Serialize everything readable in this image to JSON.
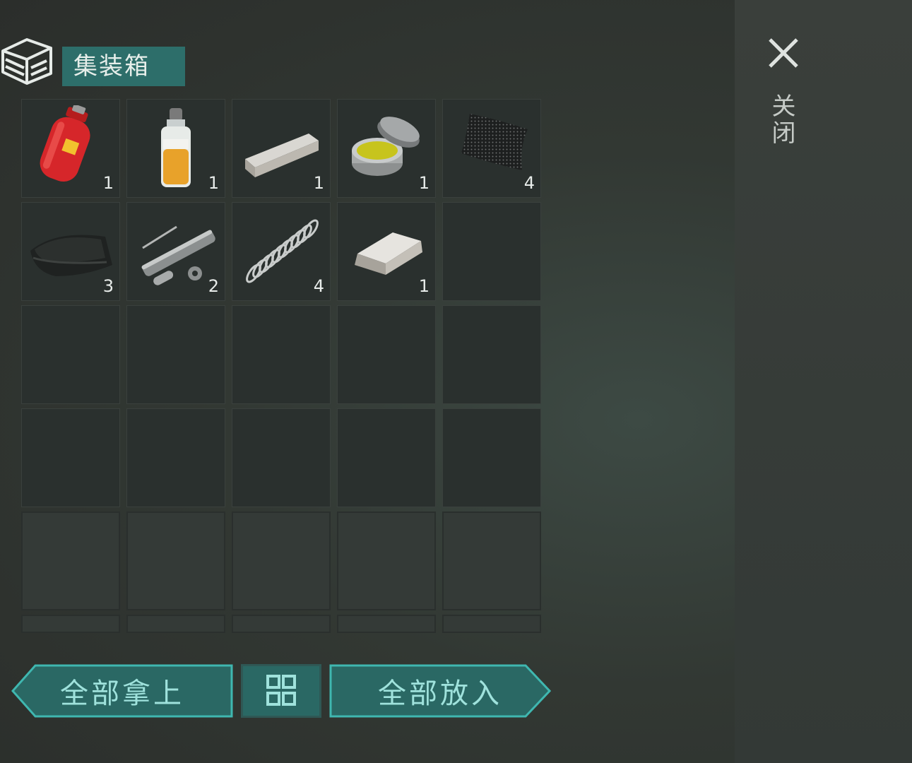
{
  "container": {
    "title": "集装箱",
    "icon": "box-stack-icon"
  },
  "close": {
    "icon": "close-x-icon",
    "label": "关闭"
  },
  "items": [
    {
      "name": "gas-canister",
      "qty": "1"
    },
    {
      "name": "liquid-bottle",
      "qty": "1"
    },
    {
      "name": "metal-bar",
      "qty": "1"
    },
    {
      "name": "ointment-tin",
      "qty": "1"
    },
    {
      "name": "mesh-fabric",
      "qty": "4"
    },
    {
      "name": "folded-cloth",
      "qty": "3"
    },
    {
      "name": "pistol-parts",
      "qty": "2"
    },
    {
      "name": "spring",
      "qty": "4"
    },
    {
      "name": "silver-ingot",
      "qty": "1"
    }
  ],
  "actions": {
    "take_all": "全部拿上",
    "sort_icon": "grid-sort-icon",
    "put_all": "全部放入"
  },
  "colors": {
    "accent": "#2d6e6a",
    "button_text": "#9fe2dc",
    "button_border": "#3fb7b0"
  }
}
